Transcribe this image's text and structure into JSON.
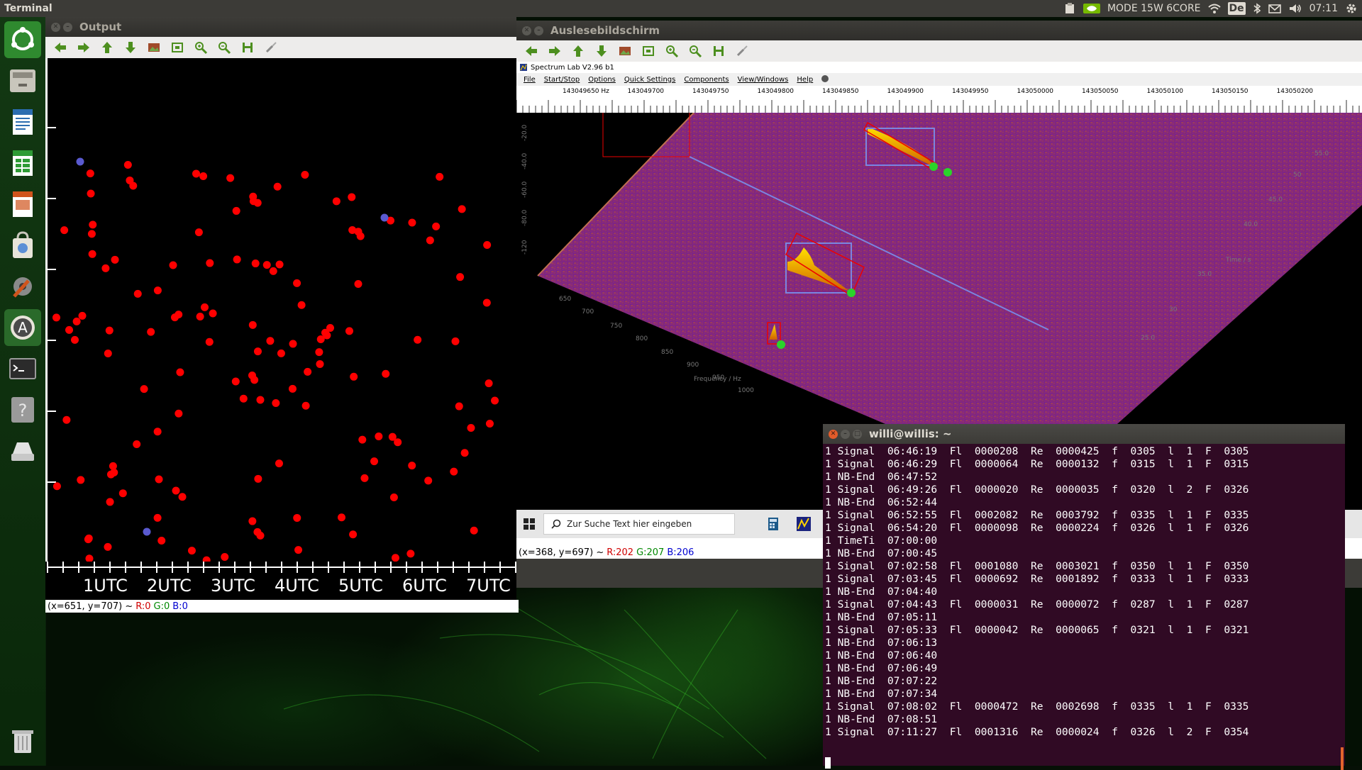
{
  "top_panel": {
    "title": "Terminal",
    "mode": "MODE 15W 6CORE",
    "keyboard": "De",
    "time": "07:11"
  },
  "output_window": {
    "title": "Output",
    "axis_labels": [
      "1UTC",
      "2UTC",
      "3UTC",
      "4UTC",
      "5UTC",
      "6UTC",
      "7UTC"
    ],
    "status": {
      "coords": "(x=651, y=707) ~",
      "r": "R:0",
      "g": "G:0",
      "b": "B:0"
    }
  },
  "ausl_window": {
    "title": "Auslesebildschirm",
    "app_title": "Spectrum Lab V2.96 b1",
    "menu": [
      "File",
      "Start/Stop",
      "Options",
      "Quick Settings",
      "Components",
      "View/Windows",
      "Help"
    ],
    "freq_labels": [
      "143049650 Hz",
      "143049700",
      "143049750",
      "143049800",
      "143049850",
      "143049900",
      "143049950",
      "143050000",
      "143050050",
      "143050100",
      "143050150",
      "143050200"
    ],
    "win_search_placeholder": "Zur Suche Text hier eingeben",
    "status": {
      "coords": "(x=368, y=697) ~",
      "r": "R:202",
      "g": "G:207",
      "b": "B:206"
    }
  },
  "terminal": {
    "title": "willi@willis: ~",
    "lines": [
      "1 Signal  06:46:19  Fl  0000208  Re  0000425  f  0305  l  1  F  0305",
      "1 Signal  06:46:29  Fl  0000064  Re  0000132  f  0315  l  1  F  0315",
      "1 NB-End  06:47:52",
      "1 Signal  06:49:26  Fl  0000020  Re  0000035  f  0320  l  2  F  0326",
      "1 NB-End  06:52:44",
      "1 Signal  06:52:55  Fl  0002082  Re  0003792  f  0335  l  1  F  0335",
      "1 Signal  06:54:20  Fl  0000098  Re  0000224  f  0326  l  1  F  0326",
      "1 TimeTi  07:00:00",
      "1 NB-End  07:00:45",
      "1 Signal  07:02:58  Fl  0001080  Re  0003021  f  0350  l  1  F  0350",
      "1 Signal  07:03:45  Fl  0000692  Re  0001892  f  0333  l  1  F  0333",
      "1 NB-End  07:04:40",
      "1 Signal  07:04:43  Fl  0000031  Re  0000072  f  0287  l  1  F  0287",
      "1 NB-End  07:05:11",
      "1 Signal  07:05:33  Fl  0000042  Re  0000065  f  0321  l  1  F  0321",
      "1 NB-End  07:06:13",
      "1 NB-End  07:06:40",
      "1 NB-End  07:06:49",
      "1 NB-End  07:07:22",
      "1 NB-End  07:07:34",
      "1 Signal  07:08:02  Fl  0000472  Re  0002698  f  0335  l  1  F  0335",
      "1 NB-End  07:08:51",
      "1 Signal  07:11:27  Fl  0001316  Re  0000024  f  0326  l  2  F  0354"
    ]
  },
  "launcher_icons": [
    "ubuntu-dash-icon",
    "files-icon",
    "writer-icon",
    "calc-icon",
    "impress-icon",
    "software-center-icon",
    "settings-icon",
    "update-manager-icon",
    "terminal-icon",
    "help-icon",
    "drive-icon",
    "trash-icon"
  ],
  "colors": {
    "accent": "#e25b2a",
    "terminal_bg": "#300a24",
    "signal_dot": "#ff0000",
    "blue_dot": "#5a5ad0",
    "launcher": "#1c4a1c"
  }
}
